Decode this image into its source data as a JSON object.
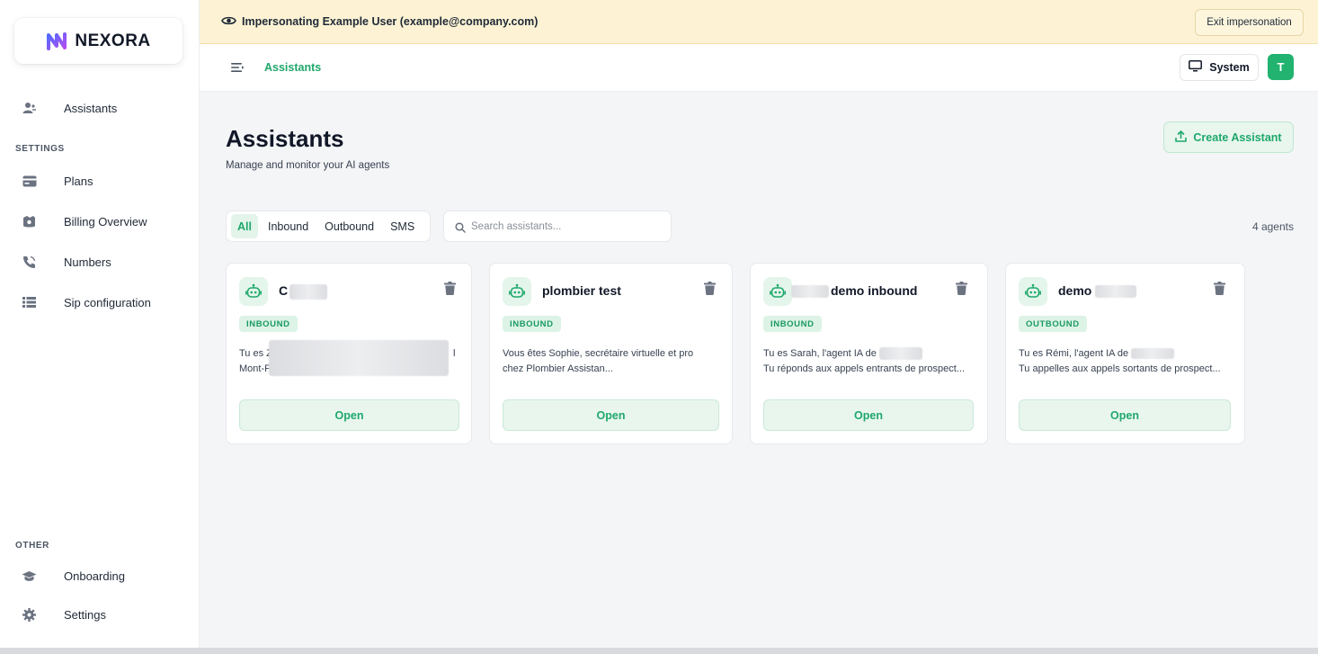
{
  "brand": {
    "name": "NEXORA",
    "colors": {
      "accent": "#1fa86b",
      "banner": "#fdf3d4",
      "avatar": "#21b36f"
    }
  },
  "sidebar": {
    "items": [
      {
        "label": "Assistants",
        "icon": "users-icon"
      }
    ],
    "settings_label": "SETTINGS",
    "settings_items": [
      {
        "label": "Plans",
        "icon": "credit-card-icon"
      },
      {
        "label": "Billing Overview",
        "icon": "wallet-icon"
      },
      {
        "label": "Numbers",
        "icon": "phone-icon"
      },
      {
        "label": "Sip configuration",
        "icon": "list-icon"
      }
    ],
    "other_label": "OTHER",
    "other_items": [
      {
        "label": "Onboarding",
        "icon": "graduation-cap-icon"
      },
      {
        "label": "Settings",
        "icon": "gear-icon"
      }
    ]
  },
  "banner": {
    "text": "Impersonating Example User (example@company.com)",
    "exit_label": "Exit impersonation"
  },
  "topbar": {
    "breadcrumb": "Assistants",
    "theme_label": "System",
    "avatar_initial": "T"
  },
  "page": {
    "title": "Assistants",
    "subtitle": "Manage and monitor your AI agents",
    "create_label": "Create Assistant",
    "filters": [
      "All",
      "Inbound",
      "Outbound",
      "SMS"
    ],
    "active_filter": "All",
    "search_placeholder": "Search assistants...",
    "count_label": "4 agents"
  },
  "cards": [
    {
      "name": "C",
      "badge": "INBOUND",
      "desc_line1": "Tu es Z",
      "desc_line1_end": "l",
      "desc_line2": "Mont-F",
      "open_label": "Open"
    },
    {
      "name": "plombier test",
      "badge": "INBOUND",
      "desc_line1": "Vous êtes Sophie, secrétaire virtuelle et pro",
      "desc_line2": "chez Plombier Assistan...",
      "open_label": "Open"
    },
    {
      "name": "demo inbound",
      "badge": "INBOUND",
      "desc_line1": "Tu es Sarah, l'agent IA de",
      "desc_line2": "Tu réponds aux appels entrants de prospect...",
      "open_label": "Open"
    },
    {
      "name": "demo",
      "badge": "OUTBOUND",
      "desc_line1": "Tu es Rémi, l'agent IA de",
      "desc_line2": "Tu appelles aux appels sortants de prospect...",
      "open_label": "Open"
    }
  ]
}
